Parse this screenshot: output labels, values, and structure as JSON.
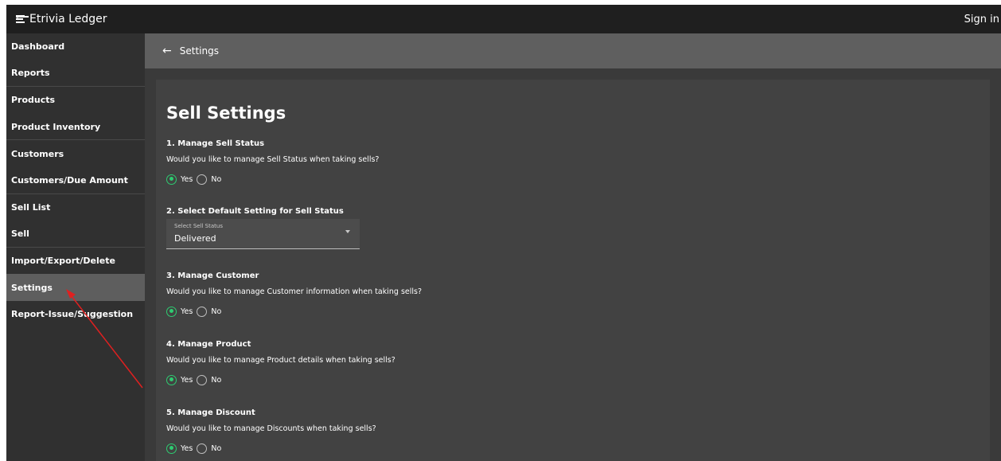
{
  "app": {
    "title": "Etrivia Ledger",
    "signin_label": "Sign in"
  },
  "sidebar": {
    "items": [
      {
        "label": "Dashboard"
      },
      {
        "label": "Reports"
      },
      {
        "label": "Products"
      },
      {
        "label": "Product Inventory"
      },
      {
        "label": "Customers"
      },
      {
        "label": "Customers/Due Amount"
      },
      {
        "label": "Sell List"
      },
      {
        "label": "Sell"
      },
      {
        "label": "Import/Export/Delete"
      },
      {
        "label": "Settings"
      },
      {
        "label": "Report-Issue/Suggestion"
      }
    ],
    "active": "Settings"
  },
  "header": {
    "title": "Settings"
  },
  "settings": {
    "title": "Sell Settings",
    "sections": [
      {
        "title": "1. Manage Sell Status",
        "question": "Would you like to manage Sell Status when taking sells?",
        "yes_label": "Yes",
        "no_label": "No",
        "selected": "Yes"
      },
      {
        "title": "2. Select Default Setting for Sell Status",
        "select_caption": "Select Sell Status",
        "select_value": "Delivered"
      },
      {
        "title": "3. Manage Customer",
        "question": "Would you like to manage Customer information when taking sells?",
        "yes_label": "Yes",
        "no_label": "No",
        "selected": "Yes"
      },
      {
        "title": "4. Manage Product",
        "question": "Would you like to manage Product details when taking sells?",
        "yes_label": "Yes",
        "no_label": "No",
        "selected": "Yes"
      },
      {
        "title": "5. Manage Discount",
        "question": "Would you like to manage Discounts when taking sells?",
        "yes_label": "Yes",
        "no_label": "No",
        "selected": "Yes"
      }
    ]
  },
  "colors": {
    "topbar": "#1f1f1f",
    "sidebar": "#303030",
    "sidebar_active": "#5e5e5e",
    "content_header": "#5f5f5f",
    "content_bg": "#3a3a3a",
    "panel_bg": "#424242",
    "radio_accent": "#2ecc71",
    "annotation_arrow": "#e02020"
  },
  "icons": {
    "menu": "menu-collapse-icon",
    "back": "arrow-left-icon",
    "caret": "caret-down-icon"
  }
}
